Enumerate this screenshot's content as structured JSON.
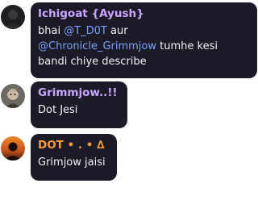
{
  "messages": [
    {
      "author": "Ichigoat {Ayush}",
      "author_color": "#c9a6ff",
      "avatar": "avatar-dark-portrait",
      "content": {
        "line1_prefix": "bhai ",
        "mention1": "@T_D0T",
        "line1_suffix": " aur",
        "mention2": "@Chronicle_Grimmjow",
        "line2_suffix": " tumhe kesi",
        "line3": "bandi chiye describe"
      }
    },
    {
      "author": "Grimmjow..!!",
      "author_color": "#c9a6ff",
      "avatar": "avatar-anime-portrait",
      "content": {
        "text": "Dot Jesi"
      }
    },
    {
      "author": "DOT • . • ∆",
      "author_color": "#ff9a3c",
      "avatar": "avatar-sunset-silhouette",
      "content": {
        "text": "Grimjow jaisi"
      }
    }
  ],
  "colors": {
    "bubble": "#1b1a26",
    "message_text": "#f2f2f5",
    "mention": "#7aa0ff",
    "page_background": "#ffffff"
  }
}
